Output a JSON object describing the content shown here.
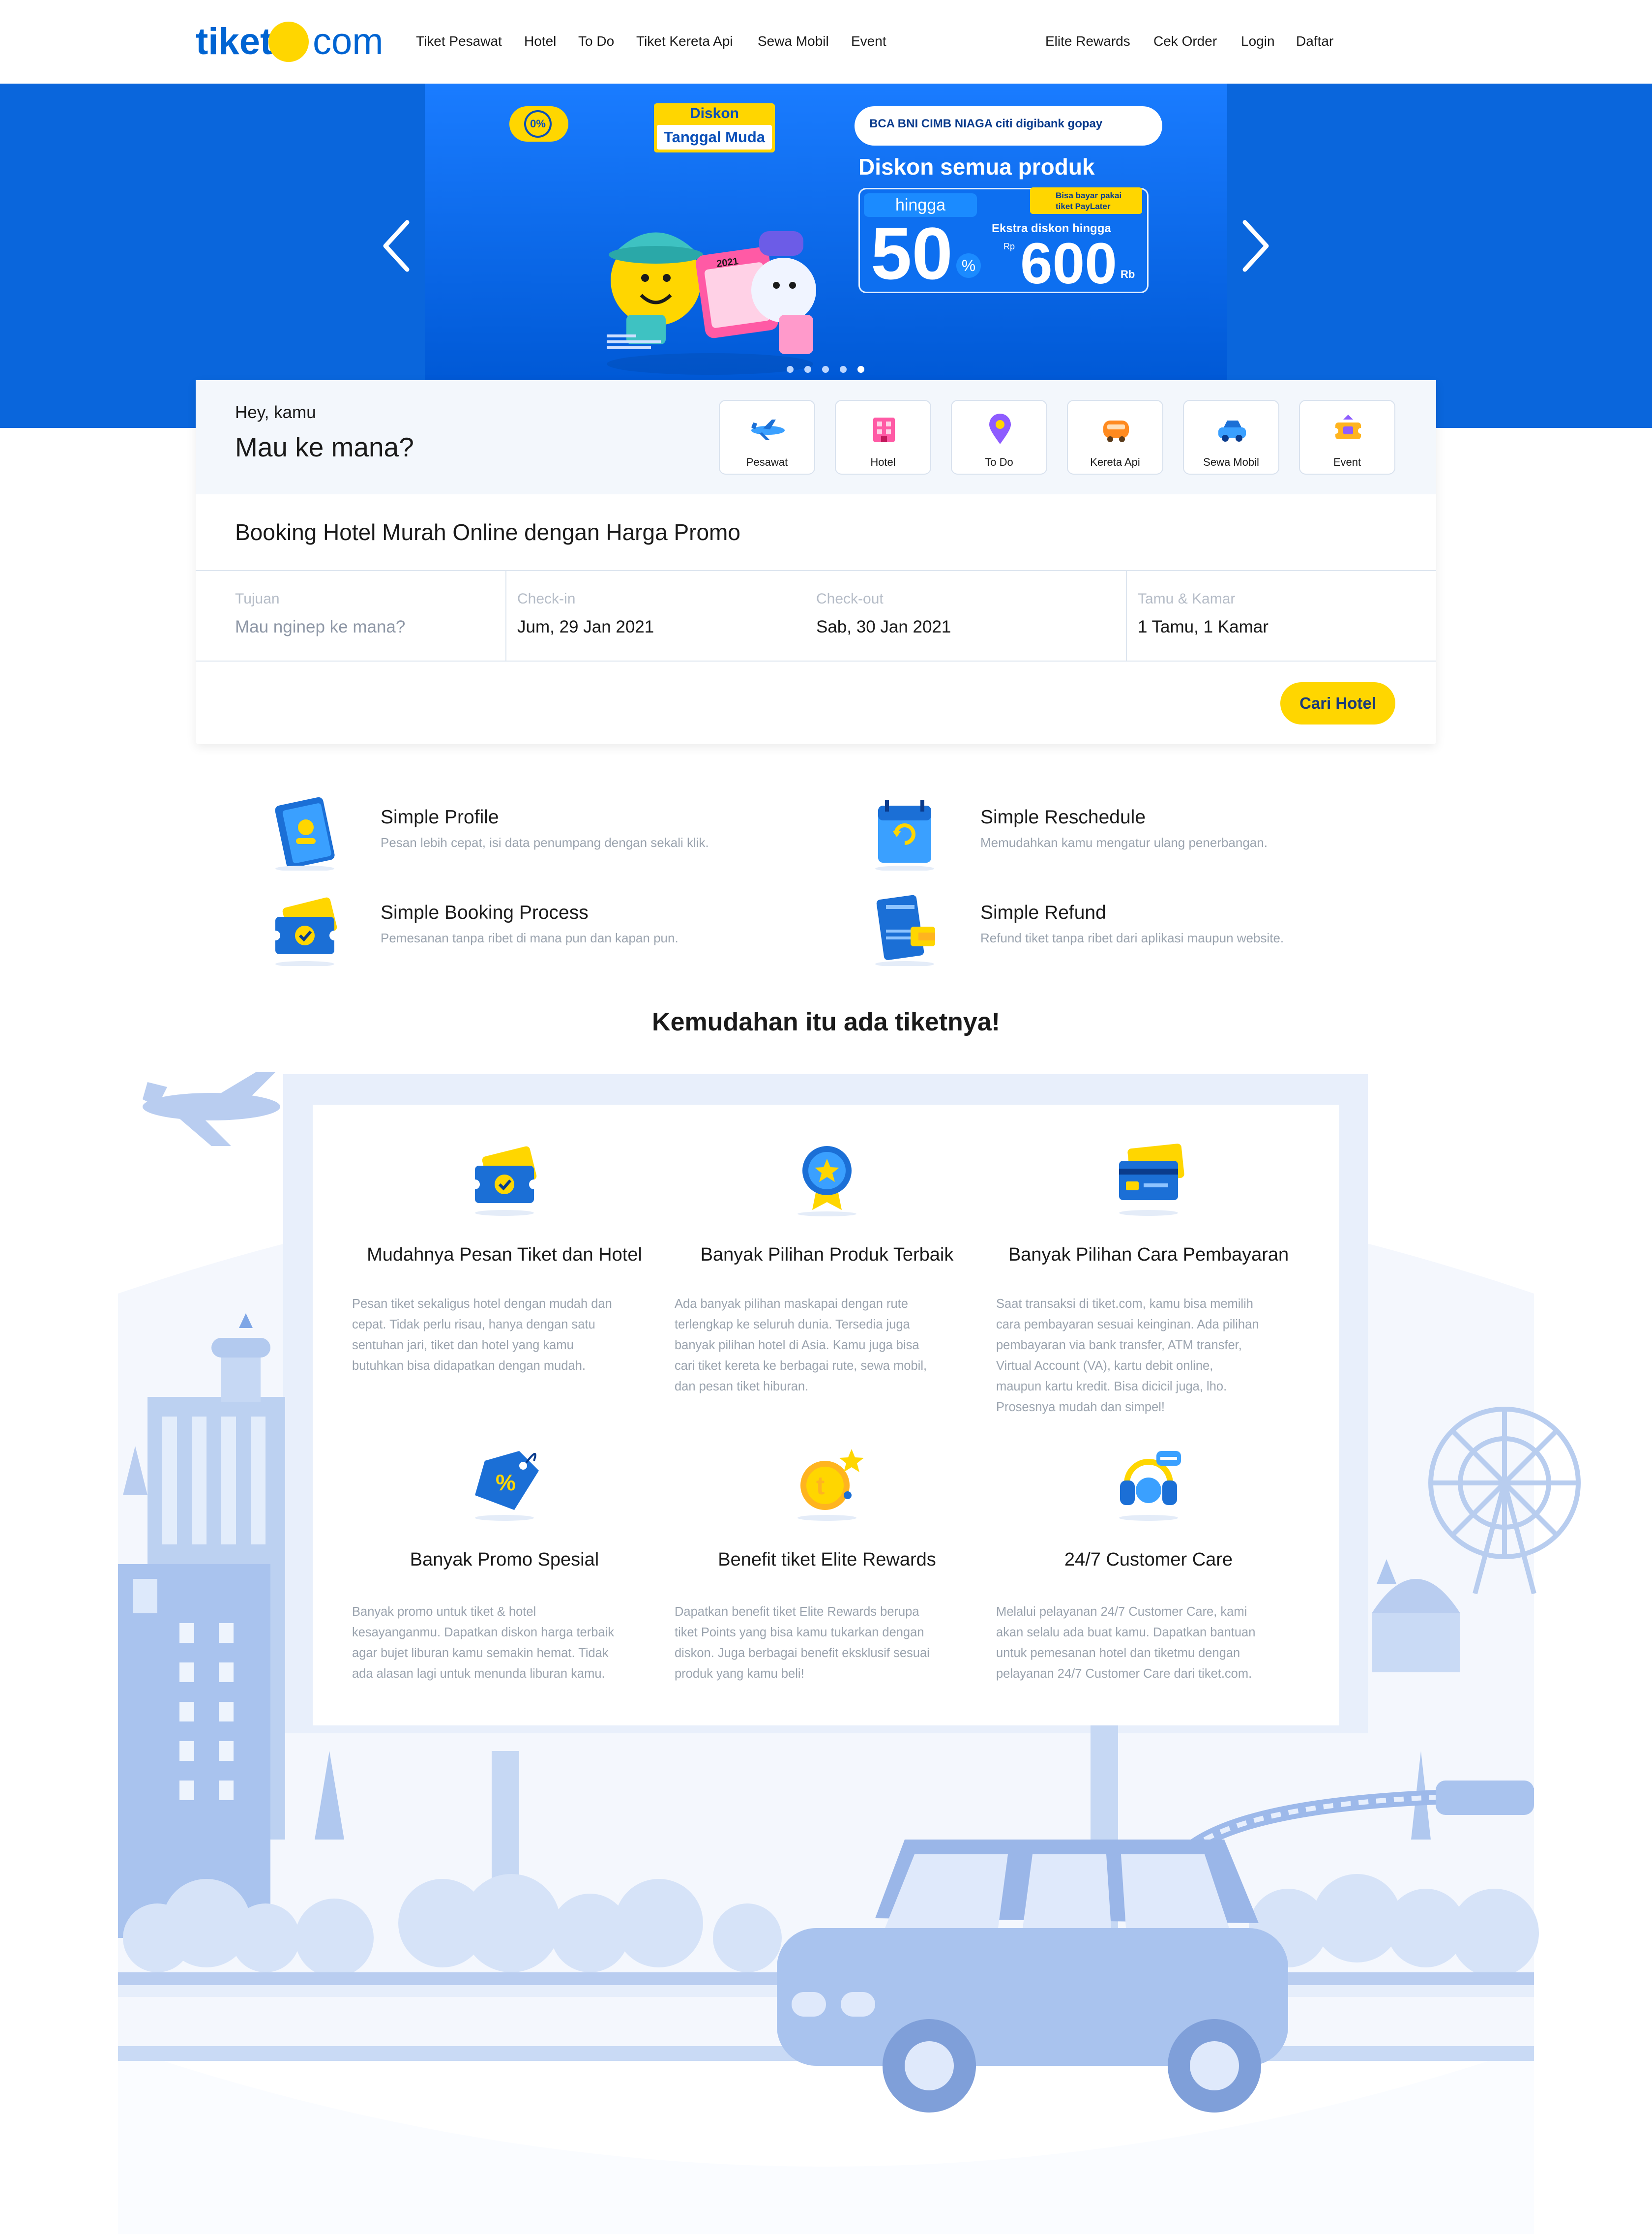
{
  "nav": {
    "logo_left": "tiket",
    "logo_right": "com",
    "links": [
      "Tiket Pesawat",
      "Hotel",
      "To Do",
      "Tiket Kereta Api",
      "Sewa Mobil",
      "Event"
    ],
    "right_links": [
      "Elite Rewards",
      "Cek Order",
      "Login",
      "Daftar"
    ]
  },
  "banner": {
    "badge": "0%",
    "tag_line1": "Diskon",
    "tag_line2": "Tanggal Muda",
    "partners": "BCA BNI CIMB NIAGA citi digibank gopay",
    "headline": "Diskon semua produk",
    "hingga": "hingga",
    "percent": "50",
    "percent_sign": "%",
    "paylater": "Bisa bayar pakai tiket PayLater",
    "extra": "Ekstra diskon hingga",
    "rp": "Rp",
    "amount": "600",
    "rb": "Rb",
    "calendar_year": "2021",
    "slides_total": 5,
    "active_slide": 5
  },
  "search": {
    "greeting": "Hey, kamu",
    "question": "Mau ke mana?",
    "products": [
      {
        "label": "Pesawat",
        "icon": "airplane-icon"
      },
      {
        "label": "Hotel",
        "icon": "hotel-icon"
      },
      {
        "label": "To Do",
        "icon": "location-pin-icon"
      },
      {
        "label": "Kereta Api",
        "icon": "train-icon"
      },
      {
        "label": "Sewa Mobil",
        "icon": "car-icon"
      },
      {
        "label": "Event",
        "icon": "ticket-icon"
      }
    ],
    "heading": "Booking Hotel Murah Online dengan Harga Promo",
    "fields": {
      "destination_label": "Tujuan",
      "destination_placeholder": "Mau nginep ke mana?",
      "checkin_label": "Check-in",
      "checkin_value": "Jum, 29 Jan 2021",
      "checkout_label": "Check-out",
      "checkout_value": "Sab, 30 Jan 2021",
      "guests_label": "Tamu & Kamar",
      "guests_value": "1 Tamu, 1 Kamar"
    },
    "submit": "Cari Hotel"
  },
  "features": [
    {
      "title": "Simple Profile",
      "desc": "Pesan lebih cepat, isi data penumpang dengan sekali klik.",
      "icon": "profile-book-icon"
    },
    {
      "title": "Simple Reschedule",
      "desc": "Memudahkan kamu mengatur ulang penerbangan.",
      "icon": "calendar-icon"
    },
    {
      "title": "Simple Booking Process",
      "desc": "Pemesanan tanpa ribet di mana pun dan kapan pun.",
      "icon": "ticket-check-icon"
    },
    {
      "title": "Simple Refund",
      "desc": "Refund tiket tanpa ribet dari aplikasi maupun website.",
      "icon": "refund-icon"
    }
  ],
  "benefits": {
    "heading": "Kemudahan itu ada tiketnya!",
    "items": [
      {
        "title": "Mudahnya Pesan Tiket dan Hotel",
        "icon": "ticket-check-icon",
        "desc": [
          "Pesan tiket sekaligus hotel dengan mudah dan",
          "cepat. Tidak perlu risau, hanya dengan satu",
          "sentuhan jari, tiket dan hotel yang kamu",
          "butuhkan bisa didapatkan dengan mudah."
        ]
      },
      {
        "title": "Banyak Pilihan Produk Terbaik",
        "icon": "star-medal-icon",
        "desc": [
          "Ada banyak pilihan maskapai dengan rute",
          "terlengkap ke seluruh dunia. Tersedia juga",
          "banyak pilihan hotel di Asia. Kamu juga bisa",
          "cari tiket kereta ke berbagai rute, sewa mobil,",
          "dan pesan tiket hiburan."
        ]
      },
      {
        "title": "Banyak Pilihan Cara Pembayaran",
        "icon": "credit-card-icon",
        "desc": [
          "Saat transaksi di tiket.com, kamu bisa memilih",
          "cara pembayaran sesuai keinginan. Ada pilihan",
          "pembayaran via bank transfer, ATM transfer,",
          "Virtual Account (VA), kartu debit online,",
          "maupun kartu kredit. Bisa dicicil juga, lho.",
          "Prosesnya mudah dan simpel!"
        ]
      },
      {
        "title": "Banyak Promo Spesial",
        "icon": "discount-tag-icon",
        "desc": [
          "Banyak promo untuk tiket & hotel",
          "kesayanganmu. Dapatkan diskon harga terbaik",
          "agar bujet liburan kamu semakin hemat. Tidak",
          "ada alasan lagi untuk menunda liburan kamu."
        ]
      },
      {
        "title": "Benefit tiket Elite Rewards",
        "icon": "coin-star-icon",
        "desc": [
          "Dapatkan benefit tiket Elite Rewards berupa",
          "tiket Points yang bisa kamu tukarkan dengan",
          "diskon. Juga berbagai benefit eksklusif sesuai",
          "produk yang kamu beli!"
        ]
      },
      {
        "title": "24/7 Customer Care",
        "icon": "headset-icon",
        "desc": [
          "Melalui pelayanan 24/7 Customer Care, kami",
          "akan selalu ada buat kamu. Dapatkan bantuan",
          "untuk pemesanan hotel dan tiketmu dengan",
          "pelayanan 24/7 Customer Care dari tiket.com."
        ]
      }
    ]
  },
  "colors": {
    "brand_blue": "#0064d2",
    "brand_yellow": "#ffd600",
    "illustration_blue": "#c9dbf7"
  }
}
